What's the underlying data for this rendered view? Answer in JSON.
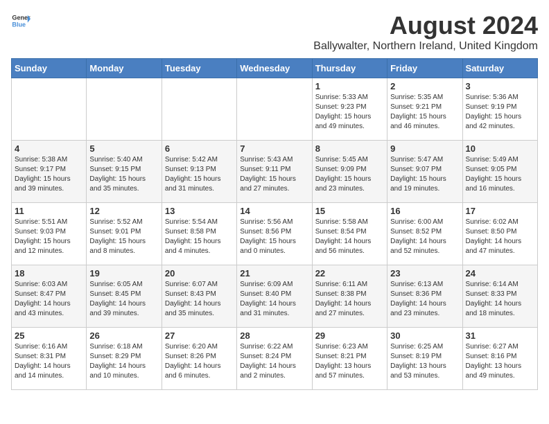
{
  "logo": {
    "general": "General",
    "blue": "Blue"
  },
  "title": "August 2024",
  "subtitle": "Ballywalter, Northern Ireland, United Kingdom",
  "days_of_week": [
    "Sunday",
    "Monday",
    "Tuesday",
    "Wednesday",
    "Thursday",
    "Friday",
    "Saturday"
  ],
  "weeks": [
    [
      {
        "day": "",
        "info": ""
      },
      {
        "day": "",
        "info": ""
      },
      {
        "day": "",
        "info": ""
      },
      {
        "day": "",
        "info": ""
      },
      {
        "day": "1",
        "info": "Sunrise: 5:33 AM\nSunset: 9:23 PM\nDaylight: 15 hours and 49 minutes."
      },
      {
        "day": "2",
        "info": "Sunrise: 5:35 AM\nSunset: 9:21 PM\nDaylight: 15 hours and 46 minutes."
      },
      {
        "day": "3",
        "info": "Sunrise: 5:36 AM\nSunset: 9:19 PM\nDaylight: 15 hours and 42 minutes."
      }
    ],
    [
      {
        "day": "4",
        "info": "Sunrise: 5:38 AM\nSunset: 9:17 PM\nDaylight: 15 hours and 39 minutes."
      },
      {
        "day": "5",
        "info": "Sunrise: 5:40 AM\nSunset: 9:15 PM\nDaylight: 15 hours and 35 minutes."
      },
      {
        "day": "6",
        "info": "Sunrise: 5:42 AM\nSunset: 9:13 PM\nDaylight: 15 hours and 31 minutes."
      },
      {
        "day": "7",
        "info": "Sunrise: 5:43 AM\nSunset: 9:11 PM\nDaylight: 15 hours and 27 minutes."
      },
      {
        "day": "8",
        "info": "Sunrise: 5:45 AM\nSunset: 9:09 PM\nDaylight: 15 hours and 23 minutes."
      },
      {
        "day": "9",
        "info": "Sunrise: 5:47 AM\nSunset: 9:07 PM\nDaylight: 15 hours and 19 minutes."
      },
      {
        "day": "10",
        "info": "Sunrise: 5:49 AM\nSunset: 9:05 PM\nDaylight: 15 hours and 16 minutes."
      }
    ],
    [
      {
        "day": "11",
        "info": "Sunrise: 5:51 AM\nSunset: 9:03 PM\nDaylight: 15 hours and 12 minutes."
      },
      {
        "day": "12",
        "info": "Sunrise: 5:52 AM\nSunset: 9:01 PM\nDaylight: 15 hours and 8 minutes."
      },
      {
        "day": "13",
        "info": "Sunrise: 5:54 AM\nSunset: 8:58 PM\nDaylight: 15 hours and 4 minutes."
      },
      {
        "day": "14",
        "info": "Sunrise: 5:56 AM\nSunset: 8:56 PM\nDaylight: 15 hours and 0 minutes."
      },
      {
        "day": "15",
        "info": "Sunrise: 5:58 AM\nSunset: 8:54 PM\nDaylight: 14 hours and 56 minutes."
      },
      {
        "day": "16",
        "info": "Sunrise: 6:00 AM\nSunset: 8:52 PM\nDaylight: 14 hours and 52 minutes."
      },
      {
        "day": "17",
        "info": "Sunrise: 6:02 AM\nSunset: 8:50 PM\nDaylight: 14 hours and 47 minutes."
      }
    ],
    [
      {
        "day": "18",
        "info": "Sunrise: 6:03 AM\nSunset: 8:47 PM\nDaylight: 14 hours and 43 minutes."
      },
      {
        "day": "19",
        "info": "Sunrise: 6:05 AM\nSunset: 8:45 PM\nDaylight: 14 hours and 39 minutes."
      },
      {
        "day": "20",
        "info": "Sunrise: 6:07 AM\nSunset: 8:43 PM\nDaylight: 14 hours and 35 minutes."
      },
      {
        "day": "21",
        "info": "Sunrise: 6:09 AM\nSunset: 8:40 PM\nDaylight: 14 hours and 31 minutes."
      },
      {
        "day": "22",
        "info": "Sunrise: 6:11 AM\nSunset: 8:38 PM\nDaylight: 14 hours and 27 minutes."
      },
      {
        "day": "23",
        "info": "Sunrise: 6:13 AM\nSunset: 8:36 PM\nDaylight: 14 hours and 23 minutes."
      },
      {
        "day": "24",
        "info": "Sunrise: 6:14 AM\nSunset: 8:33 PM\nDaylight: 14 hours and 18 minutes."
      }
    ],
    [
      {
        "day": "25",
        "info": "Sunrise: 6:16 AM\nSunset: 8:31 PM\nDaylight: 14 hours and 14 minutes."
      },
      {
        "day": "26",
        "info": "Sunrise: 6:18 AM\nSunset: 8:29 PM\nDaylight: 14 hours and 10 minutes."
      },
      {
        "day": "27",
        "info": "Sunrise: 6:20 AM\nSunset: 8:26 PM\nDaylight: 14 hours and 6 minutes."
      },
      {
        "day": "28",
        "info": "Sunrise: 6:22 AM\nSunset: 8:24 PM\nDaylight: 14 hours and 2 minutes."
      },
      {
        "day": "29",
        "info": "Sunrise: 6:23 AM\nSunset: 8:21 PM\nDaylight: 13 hours and 57 minutes."
      },
      {
        "day": "30",
        "info": "Sunrise: 6:25 AM\nSunset: 8:19 PM\nDaylight: 13 hours and 53 minutes."
      },
      {
        "day": "31",
        "info": "Sunrise: 6:27 AM\nSunset: 8:16 PM\nDaylight: 13 hours and 49 minutes."
      }
    ]
  ]
}
